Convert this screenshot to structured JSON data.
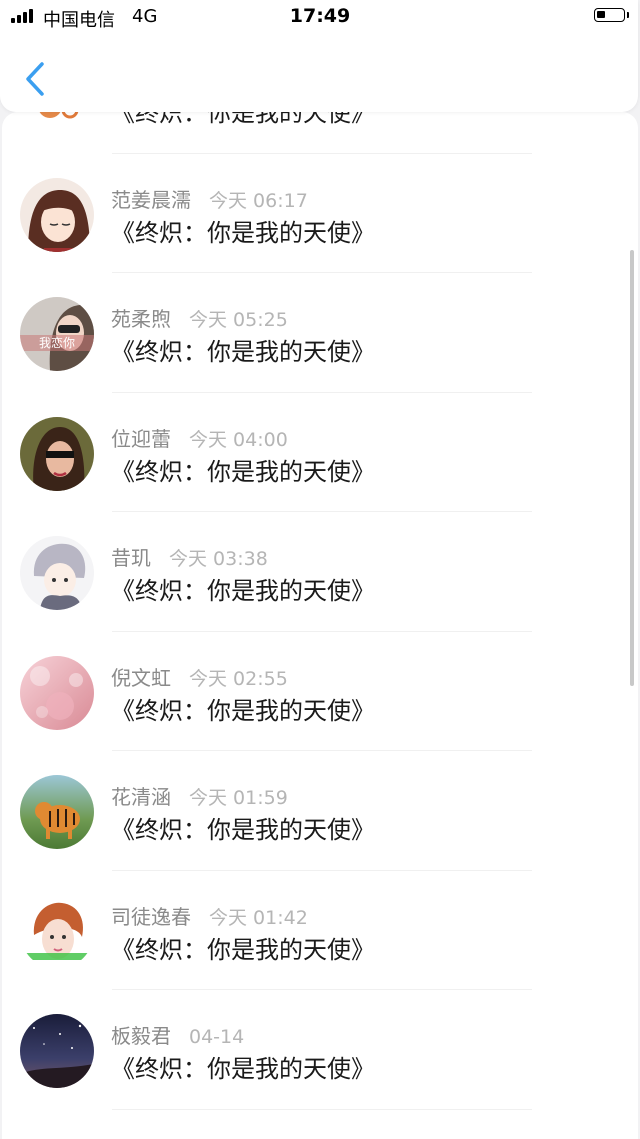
{
  "status_bar": {
    "carrier": "中国电信",
    "network": "4G",
    "time": "17:49",
    "battery_level": 0.35
  },
  "nav": {
    "back_icon": "chevron-left-icon",
    "accent_color": "#3b9ff0"
  },
  "messages": [
    {
      "name": "",
      "time": "",
      "text": "《终炽：你是我的天使》",
      "avatar": "cartoon-avatar"
    },
    {
      "name": "范姜晨濡",
      "time": "今天 06:17",
      "text": "《终炽：你是我的天使》",
      "avatar": "anime-girl-avatar"
    },
    {
      "name": "苑柔煦",
      "time": "今天 05:25",
      "text": "《终炽：你是我的天使》",
      "avatar": "sunglasses-girl-avatar",
      "avatar_caption": "我恋你"
    },
    {
      "name": "位迎蕾",
      "time": "今天 04:00",
      "text": "《终炽：你是我的天使》",
      "avatar": "woman-sunglasses-avatar"
    },
    {
      "name": "昔玑",
      "time": "今天 03:38",
      "text": "《终炽：你是我的天使》",
      "avatar": "anime-boy-avatar"
    },
    {
      "name": "倪文虹",
      "time": "今天 02:55",
      "text": "《终炽：你是我的天使》",
      "avatar": "pink-bokeh-avatar"
    },
    {
      "name": "花清涵",
      "time": "今天 01:59",
      "text": "《终炽：你是我的天使》",
      "avatar": "tiger-avatar"
    },
    {
      "name": "司徒逸春",
      "time": "今天 01:42",
      "text": "《终炽：你是我的天使》",
      "avatar": "girl-portrait-avatar"
    },
    {
      "name": "板毅君",
      "time": "04-14",
      "text": "《终炽：你是我的天使》",
      "avatar": "night-sky-avatar"
    }
  ]
}
